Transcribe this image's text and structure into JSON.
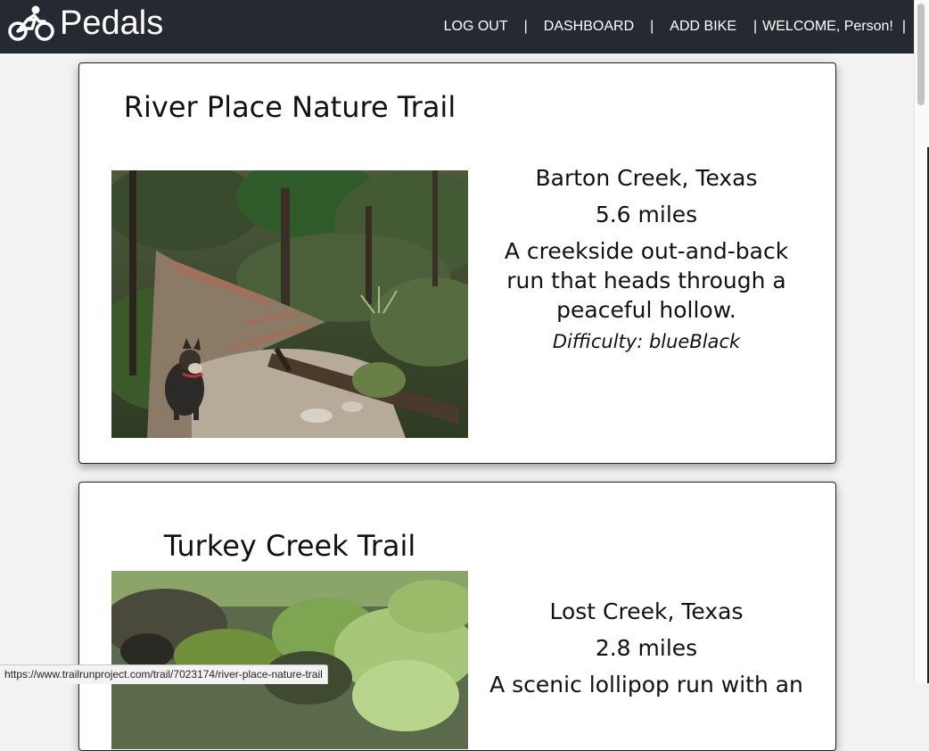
{
  "app": {
    "brand_name": "Pedals",
    "brand_icon": "bicycle-rider-icon"
  },
  "nav": {
    "logout_label": "LOG OUT",
    "dashboard_label": "DASHBOARD",
    "add_bike_label": "ADD BIKE",
    "welcome_text": "WELCOME, Person!",
    "separator": "|"
  },
  "trails": [
    {
      "name": "River Place Nature Trail",
      "location": "Barton Creek, Texas",
      "distance": "5.6 miles",
      "description": "A creekside out-and-back run that heads through a peaceful hollow.",
      "difficulty": "Difficulty: blueBlack"
    },
    {
      "name": "Turkey Creek Trail",
      "location": "Lost Creek, Texas",
      "distance": "2.8 miles",
      "description": "A scenic lollipop run with an"
    }
  ],
  "status_bar": {
    "url": "https://www.trailrunproject.com/trail/7023174/river-place-nature-trail"
  },
  "colors": {
    "topbar": "#252932",
    "page_background": "#f2f2f2",
    "card_background": "#ffffff"
  }
}
